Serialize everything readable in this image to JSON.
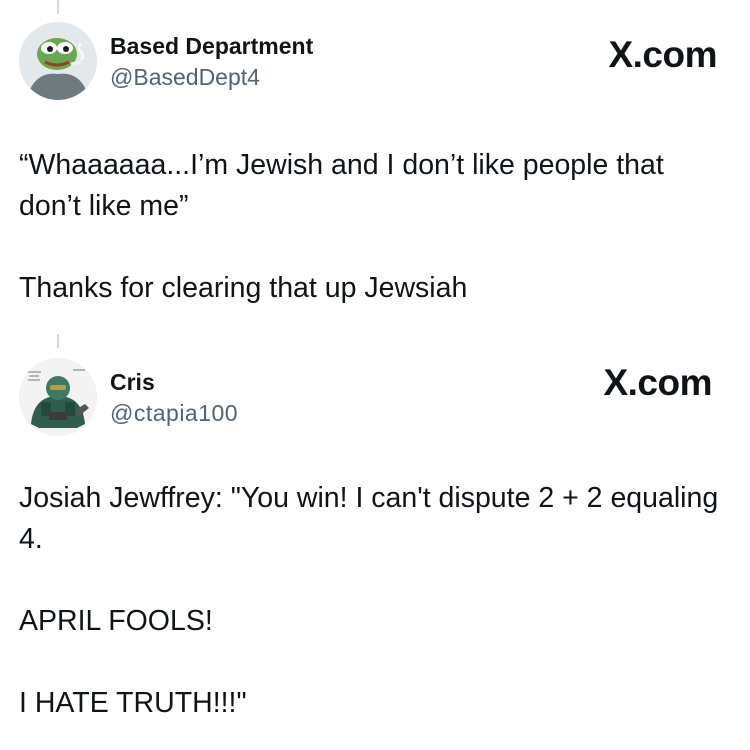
{
  "posts": [
    {
      "name": "Based Department",
      "handle": "@BasedDept4",
      "brand": "X.com",
      "avatar_icon": "frog-avatar",
      "paragraphs": [
        "“Whaaaaaa...I’m Jewish and I don’t like people that don’t like me”",
        "Thanks for clearing that up Jewsiah"
      ]
    },
    {
      "name": "Cris",
      "handle": "@ctapia100",
      "brand": "X.com",
      "avatar_icon": "armored-soldier-avatar",
      "paragraphs": [
        "Josiah Jewffrey: \"You win! I can't dispute 2 + 2 equaling 4.",
        "APRIL FOOLS!",
        "I HATE TRUTH!!!\""
      ]
    }
  ],
  "colors": {
    "text": "#0f1419",
    "secondary": "#536471",
    "thread_line": "#cfd9de"
  }
}
